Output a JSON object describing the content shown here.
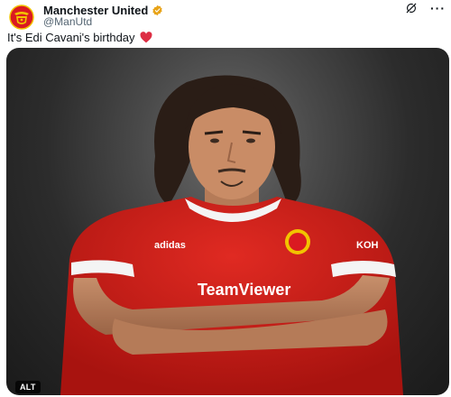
{
  "tweet": {
    "display_name": "Manchester United",
    "handle": "@ManUtd",
    "text": "It's Edi Cavani's birthday",
    "emoji": "red-heart",
    "verified_badge_color": "#e8a317"
  },
  "media": {
    "alt_label": "ALT",
    "jersey_texts": {
      "sponsor": "TeamViewer",
      "brand": "adidas",
      "sleeve": "KOH"
    },
    "colors": {
      "jersey_red": "#d7201d",
      "collar_white": "#f4f4f4",
      "background": "#3a3a3a"
    }
  },
  "icons": {
    "grok": "grok-icon",
    "more": "more-icon"
  }
}
